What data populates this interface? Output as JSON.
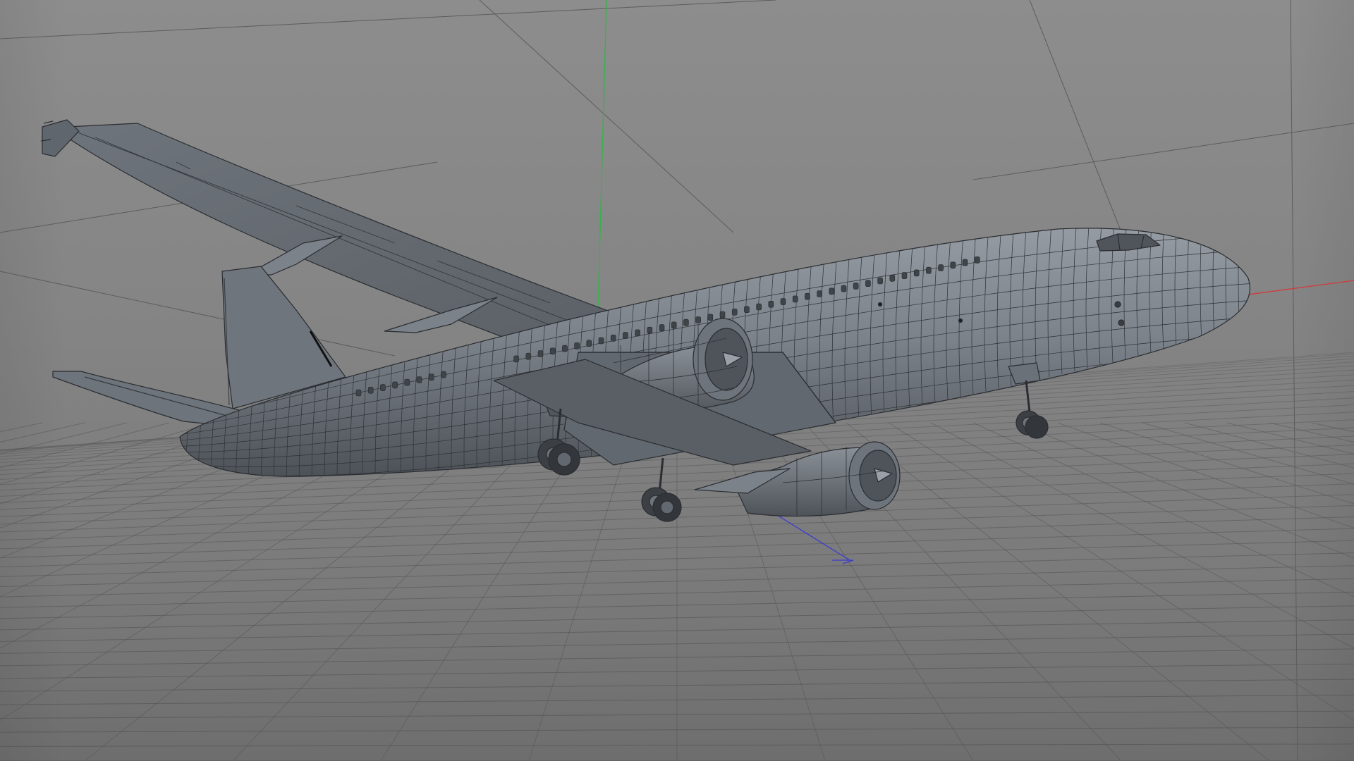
{
  "viewport": {
    "view": "perspective",
    "shading": "gouraud-lines",
    "object": "airliner-model",
    "colors": {
      "background": "#858585",
      "grid": "#5a5a5a",
      "model_fill": "#6b7178",
      "model_fill_light": "#8f959c",
      "model_fill_dark": "#4a4f55",
      "wire": "#2a2d31",
      "axis_x": "#d23a3a",
      "axis_y": "#36b24a",
      "axis_z": "#3a3ad2"
    }
  }
}
